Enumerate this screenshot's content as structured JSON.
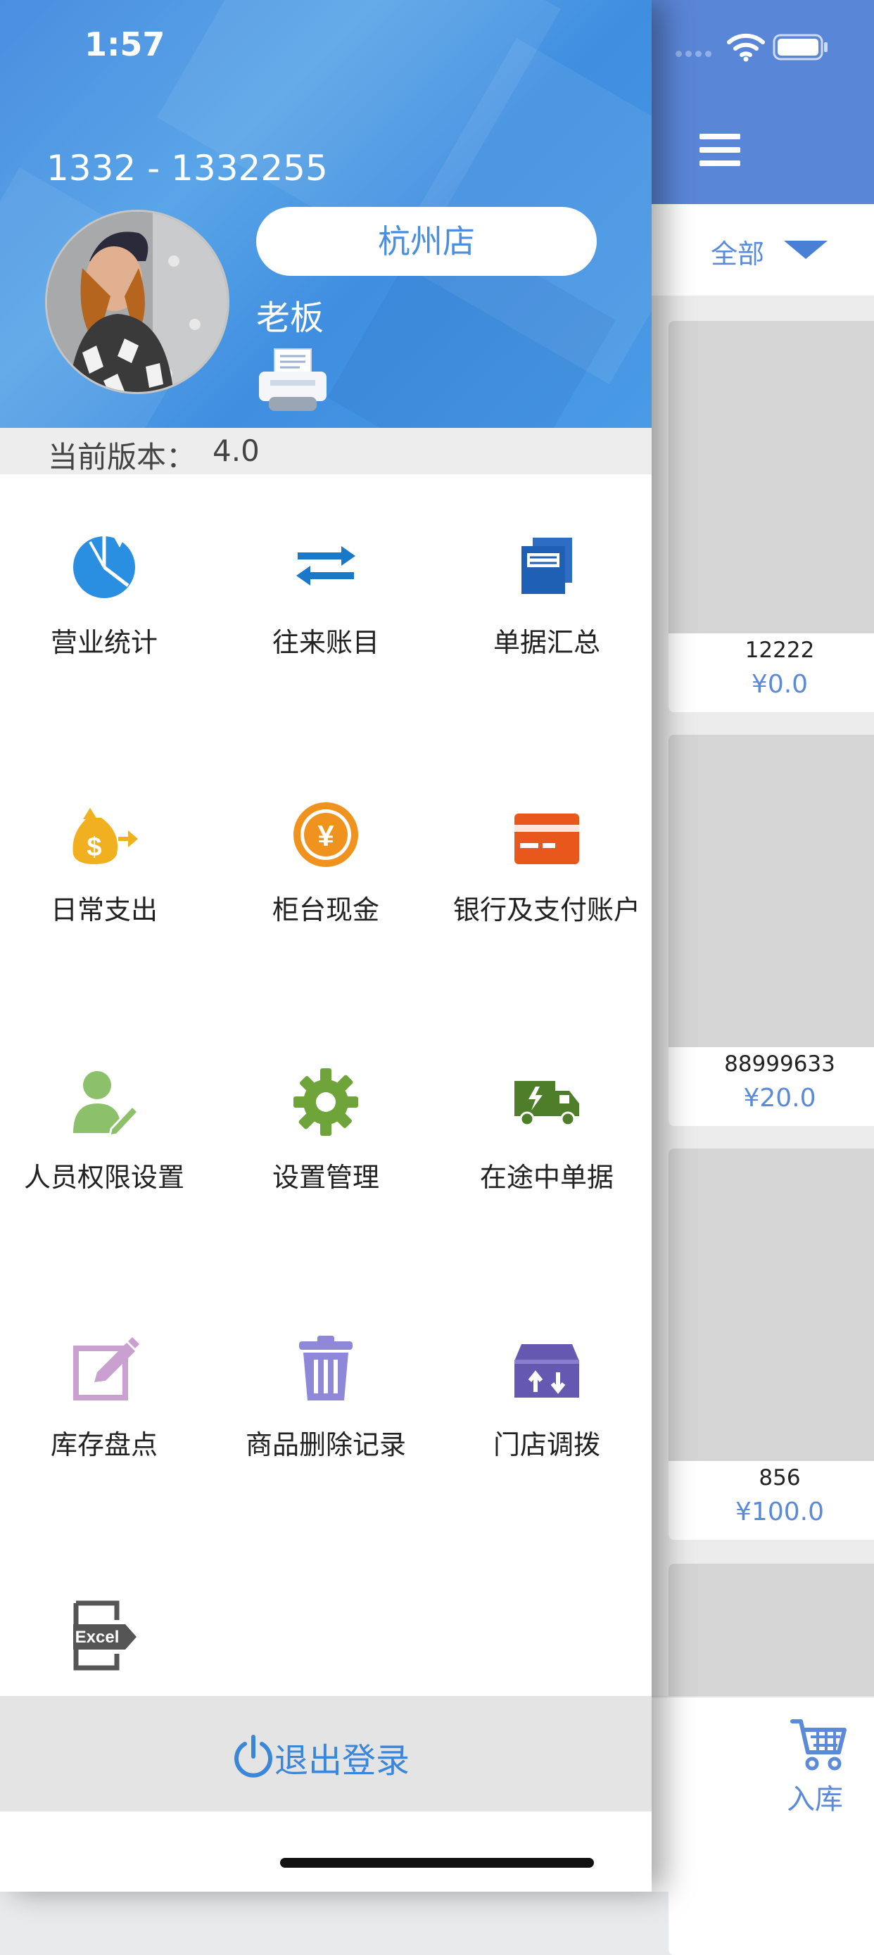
{
  "status_bar": {
    "time": "1:57"
  },
  "drawer": {
    "account": "1332 - 1332255",
    "store": "杭州店",
    "role": "老板",
    "version_label": "当前版本：",
    "version": "4.0",
    "grid": [
      {
        "label": "营业统计",
        "icon": "pie-chart-icon",
        "color": "#2a8fe0"
      },
      {
        "label": "往来账目",
        "icon": "transfer-arrows-icon",
        "color": "#1a78c8"
      },
      {
        "label": "单据汇总",
        "icon": "documents-icon",
        "color": "#1f5fb4"
      },
      {
        "label": "日常支出",
        "icon": "money-bag-icon",
        "color": "#f0b020"
      },
      {
        "label": "柜台现金",
        "icon": "yen-coin-icon",
        "color": "#f0921e"
      },
      {
        "label": "银行及支付账户",
        "icon": "bank-card-icon",
        "color": "#e8581c"
      },
      {
        "label": "人员权限设置",
        "icon": "user-edit-icon",
        "color": "#8cc06a"
      },
      {
        "label": "设置管理",
        "icon": "gear-icon",
        "color": "#6ea43a"
      },
      {
        "label": "在途中单据",
        "icon": "truck-icon",
        "color": "#4f7e2a"
      },
      {
        "label": "库存盘点",
        "icon": "edit-icon",
        "color": "#c9a0d0"
      },
      {
        "label": "商品删除记录",
        "icon": "trash-icon",
        "color": "#8f88d8"
      },
      {
        "label": "门店调拨",
        "icon": "transfer-box-icon",
        "color": "#6558b0"
      },
      {
        "label": "",
        "icon": "excel-export-icon",
        "color": "#555555"
      }
    ],
    "logout": "退出登录"
  },
  "main": {
    "filter": "全部",
    "products": [
      {
        "name": "12222",
        "price": "¥0.0"
      },
      {
        "name": "88999633",
        "price": "¥20.0"
      },
      {
        "name": "856",
        "price": "¥100.0"
      },
      {
        "name": "",
        "price": ""
      }
    ],
    "stock_in": "入库"
  }
}
